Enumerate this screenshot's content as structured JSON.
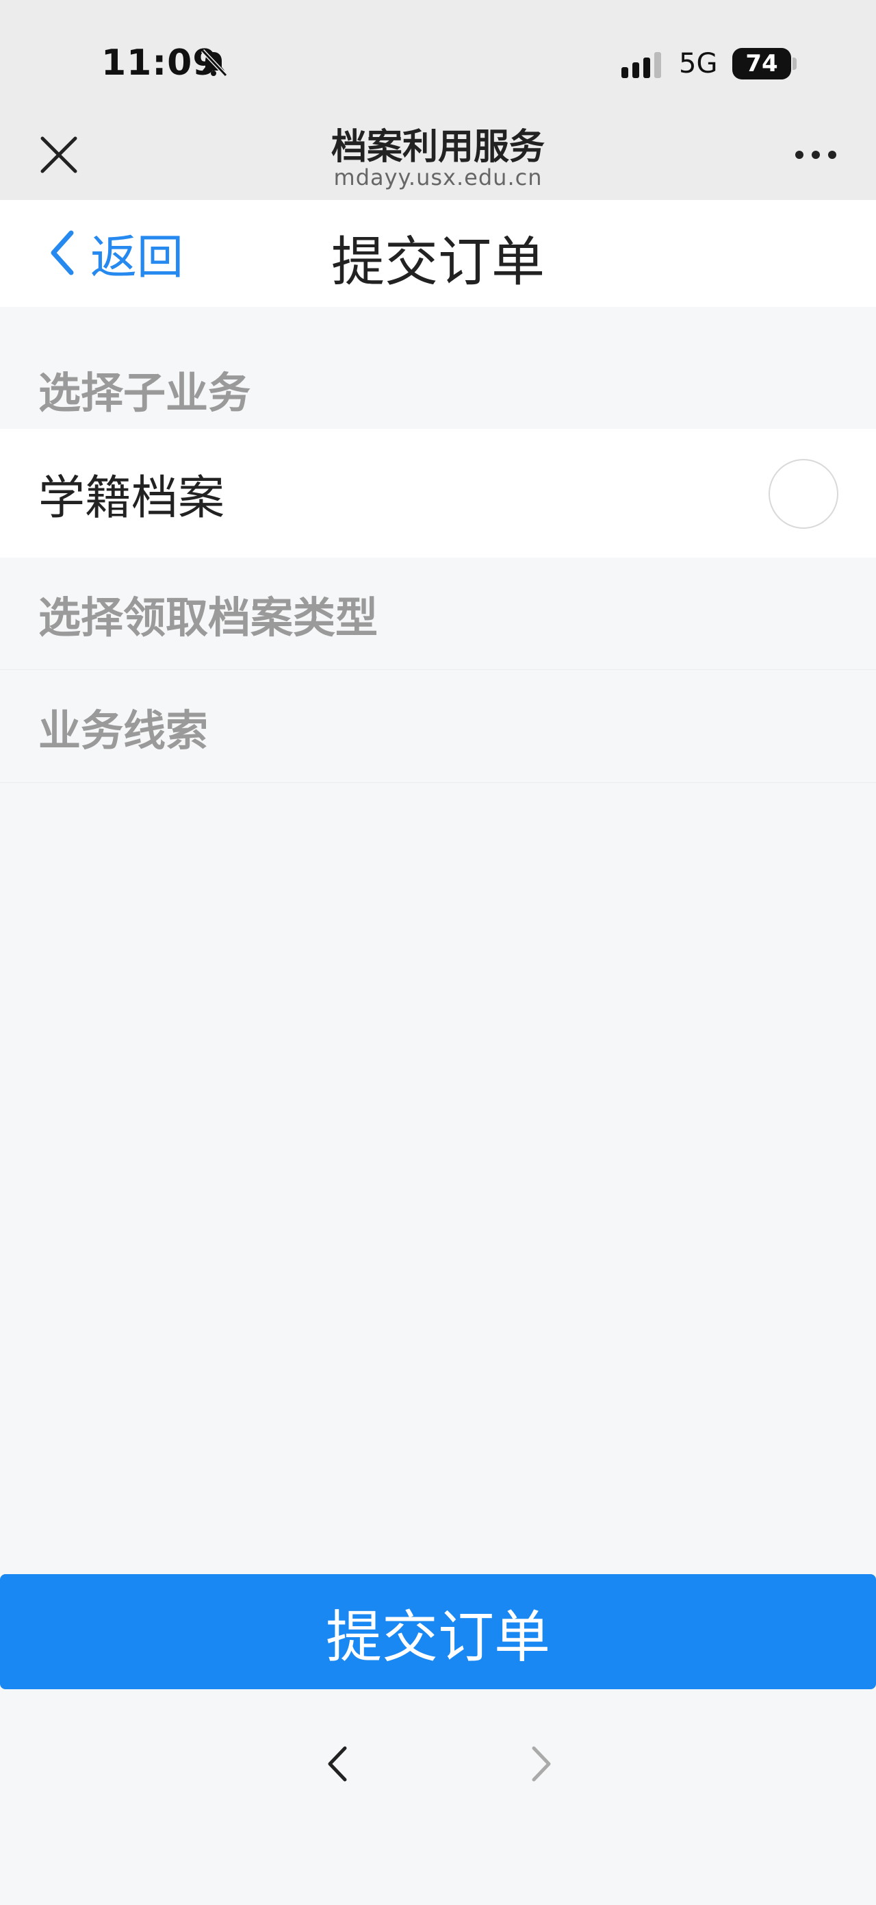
{
  "status_bar": {
    "time": "11:09",
    "network": "5G",
    "battery": "74",
    "icons": [
      "bell-slash-icon",
      "signal-icon",
      "battery-icon"
    ]
  },
  "browser": {
    "title": "档案利用服务",
    "url": "mdayy.usx.edu.cn",
    "close_icon": "close-icon",
    "more_icon": "more-dots-icon"
  },
  "navbar": {
    "back_label": "返回",
    "title": "提交订单"
  },
  "sections": {
    "sub_business": {
      "header": "选择子业务",
      "options": [
        {
          "label": "学籍档案",
          "selected": false
        }
      ]
    },
    "archive_type": {
      "header": "选择领取档案类型"
    },
    "clues": {
      "header": "业务线索"
    }
  },
  "submit": {
    "label": "提交订单",
    "color": "#1a88f2"
  },
  "colors": {
    "accent": "#2589ef",
    "header_text": "#9a9a9a",
    "background": "#f6f7f8"
  }
}
